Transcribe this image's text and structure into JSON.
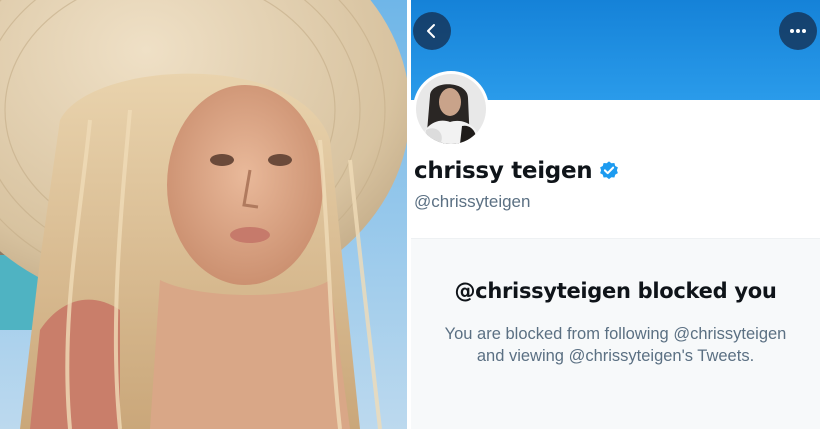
{
  "photo": {
    "icon": "selfie-photo"
  },
  "profile": {
    "name": "chrissy teigen",
    "handle": "@chrissyteigen",
    "verified": true,
    "banner_color": "#1d8fe2",
    "verified_color": "#1d9bf0"
  },
  "blocked": {
    "title": "@chrissyteigen blocked you",
    "line1": "You are blocked from following @chrissyteigen",
    "line2": "and viewing @chrissyteigen's Tweets."
  },
  "icons": {
    "back": "chevron-left-icon",
    "more": "more-horizontal-icon",
    "verified": "verified-badge-icon"
  }
}
